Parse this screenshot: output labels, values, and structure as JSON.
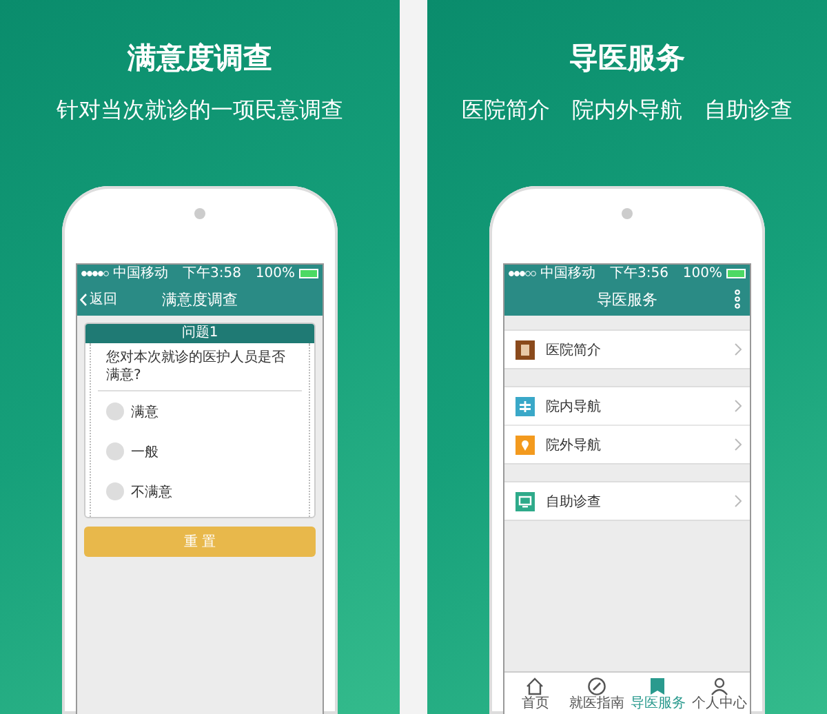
{
  "panels": [
    {
      "kind": "survey",
      "title": "满意度调查",
      "subtitle": [
        "针对当次就诊的一项民意调查"
      ],
      "status": {
        "carrier": "中国移动",
        "time": "下午3:58",
        "battery": "100%"
      },
      "nav": {
        "back": "返回",
        "title": "满意度调查"
      },
      "question": {
        "heading": "问题1",
        "text": "您对本次就诊的医护人员是否满意?",
        "options": [
          {
            "label": "满意",
            "selected": false
          },
          {
            "label": "一般",
            "selected": false
          },
          {
            "label": "不满意",
            "selected": false
          }
        ]
      },
      "button": "重 置"
    },
    {
      "kind": "menu",
      "title": "导医服务",
      "subtitle": [
        "医院简介",
        "院内外导航",
        "自助诊查"
      ],
      "status": {
        "carrier": "中国移动",
        "time": "下午3:56",
        "battery": "100%"
      },
      "nav": {
        "title": "导医服务"
      },
      "groups": [
        [
          {
            "label": "医院简介",
            "color": "#8a4a1c"
          }
        ],
        [
          {
            "label": "院内导航",
            "color": "#3aa8c8"
          },
          {
            "label": "院外导航",
            "color": "#f39a1e"
          }
        ],
        [
          {
            "label": "自助诊查",
            "color": "#2eaa8a"
          }
        ]
      ],
      "tabs": [
        {
          "label": "首页",
          "selected": false
        },
        {
          "label": "就医指南",
          "selected": false
        },
        {
          "label": "导医服务",
          "selected": true
        },
        {
          "label": "个人中心",
          "selected": false
        }
      ]
    }
  ]
}
